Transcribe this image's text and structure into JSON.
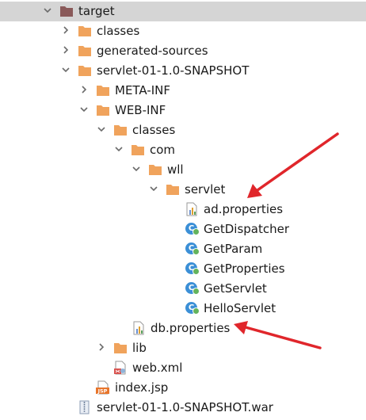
{
  "tree": {
    "target": "target",
    "classes_top": "classes",
    "generated_sources": "generated-sources",
    "snapshot_dir": "servlet-01-1.0-SNAPSHOT",
    "meta_inf": "META-INF",
    "web_inf": "WEB-INF",
    "classes_inner": "classes",
    "com": "com",
    "wll": "wll",
    "servlet": "servlet",
    "ad_properties": "ad.properties",
    "class_files": [
      "GetDispatcher",
      "GetParam",
      "GetProperties",
      "GetServlet",
      "HelloServlet"
    ],
    "class_badge": "C",
    "db_properties": "db.properties",
    "lib": "lib",
    "web_xml": "web.xml",
    "index_jsp": "index.jsp",
    "jsp_badge": "JSP",
    "war_file": "servlet-01-1.0-SNAPSHOT.war"
  },
  "colors": {
    "folder": "#f0a35c",
    "folder_dark": "#8a5a5a",
    "selection": "#d5d5d5",
    "class_icon": "#3b8fd6",
    "annotation_arrow": "#e0262b",
    "chevron": "#6b6b6b"
  },
  "icons": {
    "folder": "folder-icon",
    "target_folder": "excluded-folder-icon",
    "properties": "properties-file-icon",
    "class": "java-class-icon",
    "xml": "xml-file-icon",
    "jsp": "jsp-file-icon",
    "war": "war-archive-icon",
    "expanded": "chevron-down-icon",
    "collapsed": "chevron-right-icon"
  }
}
